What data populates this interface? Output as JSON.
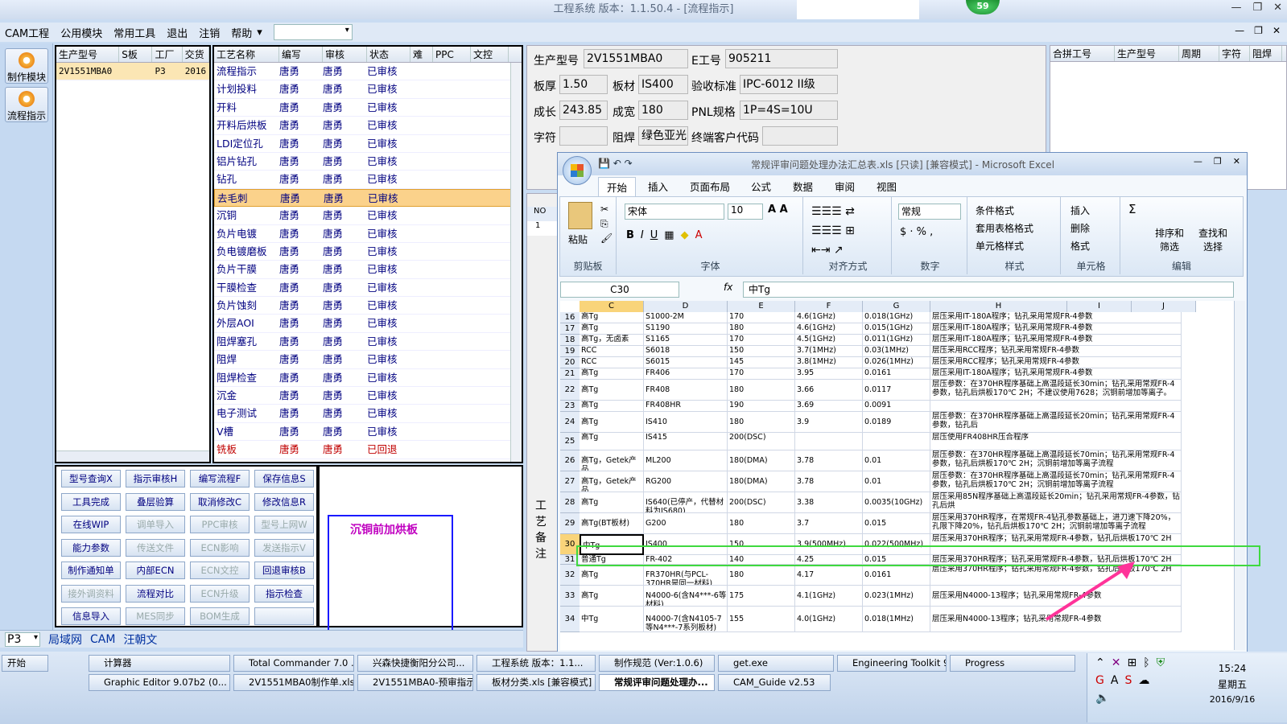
{
  "app": {
    "title": "工程系统   版本：1.1.50.4 - [流程指示]",
    "badge": "59",
    "win_min": "—",
    "win_max": "❐",
    "win_close": "✕"
  },
  "menu": [
    "CAM工程",
    "公用模块",
    "常用工具",
    "退出",
    "注销",
    "帮助"
  ],
  "menu_more": "▾",
  "sidebar": [
    {
      "label": "制作模块"
    },
    {
      "label": "流程指示"
    }
  ],
  "orders": {
    "headers": [
      "生产型号",
      "S板",
      "工厂",
      "交货"
    ],
    "rows": [
      [
        "2V1551MBA0",
        "",
        "P3",
        "2016"
      ]
    ]
  },
  "process": {
    "headers": [
      "工艺名称",
      "编写",
      "审核",
      "状态",
      "难",
      "PPC",
      "文控"
    ],
    "rows": [
      [
        "流程指示",
        "唐勇",
        "唐勇",
        "已审核"
      ],
      [
        "计划投料",
        "唐勇",
        "唐勇",
        "已审核"
      ],
      [
        "开料",
        "唐勇",
        "唐勇",
        "已审核"
      ],
      [
        "开料后烘板",
        "唐勇",
        "唐勇",
        "已审核"
      ],
      [
        "LDI定位孔",
        "唐勇",
        "唐勇",
        "已审核"
      ],
      [
        "铝片钻孔",
        "唐勇",
        "唐勇",
        "已审核"
      ],
      [
        "钻孔",
        "唐勇",
        "唐勇",
        "已审核"
      ],
      [
        "去毛刺",
        "唐勇",
        "唐勇",
        "已审核"
      ],
      [
        "沉铜",
        "唐勇",
        "唐勇",
        "已审核"
      ],
      [
        "负片电镀",
        "唐勇",
        "唐勇",
        "已审核"
      ],
      [
        "负电镀磨板",
        "唐勇",
        "唐勇",
        "已审核"
      ],
      [
        "负片干膜",
        "唐勇",
        "唐勇",
        "已审核"
      ],
      [
        "干膜检查",
        "唐勇",
        "唐勇",
        "已审核"
      ],
      [
        "负片蚀刻",
        "唐勇",
        "唐勇",
        "已审核"
      ],
      [
        "外层AOI",
        "唐勇",
        "唐勇",
        "已审核"
      ],
      [
        "阻焊塞孔",
        "唐勇",
        "唐勇",
        "已审核"
      ],
      [
        "阻焊",
        "唐勇",
        "唐勇",
        "已审核"
      ],
      [
        "阻焊检查",
        "唐勇",
        "唐勇",
        "已审核"
      ],
      [
        "沉金",
        "唐勇",
        "唐勇",
        "已审核"
      ],
      [
        "电子测试",
        "唐勇",
        "唐勇",
        "已审核"
      ],
      [
        "V槽",
        "唐勇",
        "唐勇",
        "已审核"
      ],
      [
        "铣板",
        "唐勇",
        "唐勇",
        "已回退"
      ]
    ]
  },
  "commands": [
    [
      "型号查询X",
      "指示审核H",
      "编写流程F",
      "保存信息S"
    ],
    [
      "工具完成",
      "叠层验算",
      "取消修改C",
      "修改信息R"
    ],
    [
      "在线WIP",
      "调单导入",
      "PPC审核",
      "型号上网W"
    ],
    [
      "能力参数",
      "传送文件",
      "ECN影响",
      "发送指示V"
    ],
    [
      "制作通知单",
      "内部ECN",
      "ECN文控",
      "回退审核B"
    ],
    [
      "接外调资料",
      "流程对比",
      "ECN升级",
      "指示检查"
    ],
    [
      "信息导入",
      "MES同步",
      "BOM生成",
      ""
    ]
  ],
  "commands_disabled": [
    "调单导入",
    "PPC审核",
    "型号上网W",
    "传送文件",
    "ECN影响",
    "发送指示V",
    "ECN文控",
    "接外调资料",
    "ECN升级",
    "MES同步",
    "BOM生成"
  ],
  "note": "沉铜前加烘板",
  "info": {
    "labels": [
      "生产型号",
      "E工号",
      "板厚",
      "板材",
      "验收标准",
      "成长",
      "成宽",
      "PNL规格",
      "字符",
      "阻焊",
      "终端客户代码"
    ],
    "model": "2V1551MBA0",
    "eno": "905211",
    "thickness": "1.50",
    "material": "IS400",
    "standard": "IPC-6012 II级",
    "length": "243.85",
    "width": "180",
    "pnl": "1P=4S=10U",
    "silk": "",
    "mask": "绿色亚光",
    "client": ""
  },
  "merge_headers": [
    "合拼工号",
    "生产型号",
    "周期",
    "字符",
    "阻焊"
  ],
  "no_label": "NO",
  "no_value": "1",
  "process_note_label": "工艺备注",
  "bottom": {
    "factory": "P3",
    "tabs": [
      "局域网",
      "CAM",
      "汪朝文"
    ]
  },
  "excel": {
    "title": "常规评审问题处理办法汇总表.xls  [只读]  [兼容模式] - Microsoft Excel",
    "tabs": [
      "开始",
      "插入",
      "页面布局",
      "公式",
      "数据",
      "审阅",
      "视图"
    ],
    "font_name": "宋体",
    "font_size": "10",
    "number_format": "常规",
    "groups": [
      "剪贴板",
      "字体",
      "对齐方式",
      "数字",
      "样式",
      "单元格",
      "编辑"
    ],
    "paste": "粘贴",
    "style_btns": [
      "条件格式",
      "套用表格格式",
      "单元格样式"
    ],
    "cell_btns": [
      "插入",
      "删除",
      "格式"
    ],
    "edit_btns": [
      "排序和筛选",
      "查找和选择"
    ],
    "namebox": "C30",
    "fx": "fx",
    "formula": "中Tg",
    "cols": [
      "C",
      "D",
      "E",
      "F",
      "G",
      "H",
      "I",
      "J"
    ],
    "rows": [
      {
        "n": "16",
        "c": "高Tg",
        "d": "S1000-2M",
        "e": "170",
        "f": "4.6(1GHz)",
        "g": "0.018(1GHz)",
        "h": "层压采用IT-180A程序；钻孔采用常规FR-4参数"
      },
      {
        "n": "17",
        "c": "高Tg",
        "d": "S1190",
        "e": "180",
        "f": "4.6(1GHz)",
        "g": "0.015(1GHz)",
        "h": "层压采用IT-180A程序；钻孔采用常规FR-4参数"
      },
      {
        "n": "18",
        "c": "高Tg，无卤素",
        "d": "S1165",
        "e": "170",
        "f": "4.5(1GHz)",
        "g": "0.011(1GHz)",
        "h": "层压采用IT-180A程序；钻孔采用常规FR-4参数"
      },
      {
        "n": "19",
        "c": "RCC",
        "d": "S6018",
        "e": "150",
        "f": "3.7(1MHz)",
        "g": "0.03(1MHz)",
        "h": "层压采用RCC程序；钻孔采用常规FR-4参数"
      },
      {
        "n": "20",
        "c": "RCC",
        "d": "S6015",
        "e": "145",
        "f": "3.8(1MHz)",
        "g": "0.026(1MHz)",
        "h": "层压采用RCC程序；钻孔采用常规FR-4参数"
      },
      {
        "n": "21",
        "c": "高Tg",
        "d": "FR406",
        "e": "170",
        "f": "3.95",
        "g": "0.0161",
        "h": "层压采用IT-180A程序；钻孔采用常规FR-4参数"
      },
      {
        "n": "22",
        "c": "高Tg",
        "d": "FR408",
        "e": "180",
        "f": "3.66",
        "g": "0.0117",
        "h": "层压参数：在370HR程序基础上高温段延长30min；钻孔采用常规FR-4参数，钻孔后烘板170℃ 2H；不建议使用7628；沉铜前增加等离子。"
      },
      {
        "n": "23",
        "c": "高Tg",
        "d": "FR408HR",
        "e": "190",
        "f": "3.69",
        "g": "0.0091",
        "h": ""
      },
      {
        "n": "24",
        "c": "高Tg",
        "d": "IS410",
        "e": "180",
        "f": "3.9",
        "g": "0.0189",
        "h": "层压参数：在370HR程序基础上高温段延长20min；钻孔采用常规FR-4参数，钻孔后"
      },
      {
        "n": "25",
        "c": "高Tg",
        "d": "IS415",
        "e": "200(DSC)",
        "f": "",
        "g": "",
        "h": "层压使用FR408HR压合程序"
      },
      {
        "n": "26",
        "c": "高Tg，Getek产品",
        "d": "ML200",
        "e": "180(DMA)",
        "f": "3.78",
        "g": "0.01",
        "h": "层压参数：在370HR程序基础上高温段延长70min；钻孔采用常规FR-4参数，钻孔后烘板170℃ 2H；沉铜前增加等离子流程"
      },
      {
        "n": "27",
        "c": "高Tg，Getek产品",
        "d": "RG200",
        "e": "180(DMA)",
        "f": "3.78",
        "g": "0.01",
        "h": "层压参数：在370HR程序基础上高温段延长70min；钻孔采用常规FR-4参数，钻孔后烘板170℃ 2H；沉铜前增加等离子流程"
      },
      {
        "n": "28",
        "c": "高Tg",
        "d": "IS640(已停产，代替材料为IS680)",
        "e": "200(DSC)",
        "f": "3.38",
        "g": "0.0035(10GHz)",
        "h": "层压采用85N程序基础上高温段延长20min；钻孔采用常规FR-4参数，钻孔后烘"
      },
      {
        "n": "29",
        "c": "高Tg(BT板材)",
        "d": "G200",
        "e": "180",
        "f": "3.7",
        "g": "0.015",
        "h": "层压采用370HR程序，在常规FR-4钻孔参数基础上，进刀速下降20%，孔限下降20%，钻孔后烘板170℃ 2H；沉铜前增加等离子流程"
      },
      {
        "n": "30",
        "c": "中Tg",
        "d": "IS400",
        "e": "150",
        "f": "3.9(500MHz)",
        "g": "0.022(500MHz)",
        "h": "层压采用370HR程序；钻孔采用常规FR-4参数，钻孔后烘板170℃ 2H"
      },
      {
        "n": "31",
        "c": "普通Tg",
        "d": "FR-402",
        "e": "140",
        "f": "4.25",
        "g": "0.015",
        "h": "层压采用370HR程序；钻孔采用常规FR-4参数，钻孔后烘板170℃ 2H"
      },
      {
        "n": "32",
        "c": "高Tg",
        "d": "FR370HR(与PCL-370HR是同一材料)",
        "e": "180",
        "f": "4.17",
        "g": "0.0161",
        "h": "层压采用370HR程序；钻孔采用常规FR-4参数，钻孔后烘板170℃ 2H"
      },
      {
        "n": "33",
        "c": "高Tg",
        "d": "N4000-6(含N4***-6等材料)",
        "e": "175",
        "f": "4.1(1GHz)",
        "g": "0.023(1MHz)",
        "h": "层压采用N4000-13程序；钻孔采用常规FR-4参数"
      },
      {
        "n": "34",
        "c": "中Tg",
        "d": "N4000-7(含N4105-7等N4***-7系列板材)",
        "e": "155",
        "f": "4.0(1GHz)",
        "g": "0.018(1MHz)",
        "h": "层压采用N4000-13程序；钻孔采用常规FR-4参数"
      }
    ]
  },
  "taskbar": {
    "start": "开始",
    "row1": [
      "计算器",
      "Total Commander 7.0 ...",
      "兴森快捷衡阳分公司...",
      "工程系统  版本：1.1...",
      "制作规范 (Ver:1.0.6)",
      "get.exe",
      "Engineering Toolkit 9.0...",
      "Progress"
    ],
    "row2": [
      "Graphic Editor 9.07b2 (0...",
      "2V1551MBA0制作单.xls ...",
      "2V1551MBA0-预审指示...",
      "板材分类.xls [兼容模式]",
      "常规评审问题处理办...",
      "CAM_Guide v2.53"
    ],
    "time": "15:24",
    "weekday": "星期五",
    "date": "2016/9/16"
  }
}
